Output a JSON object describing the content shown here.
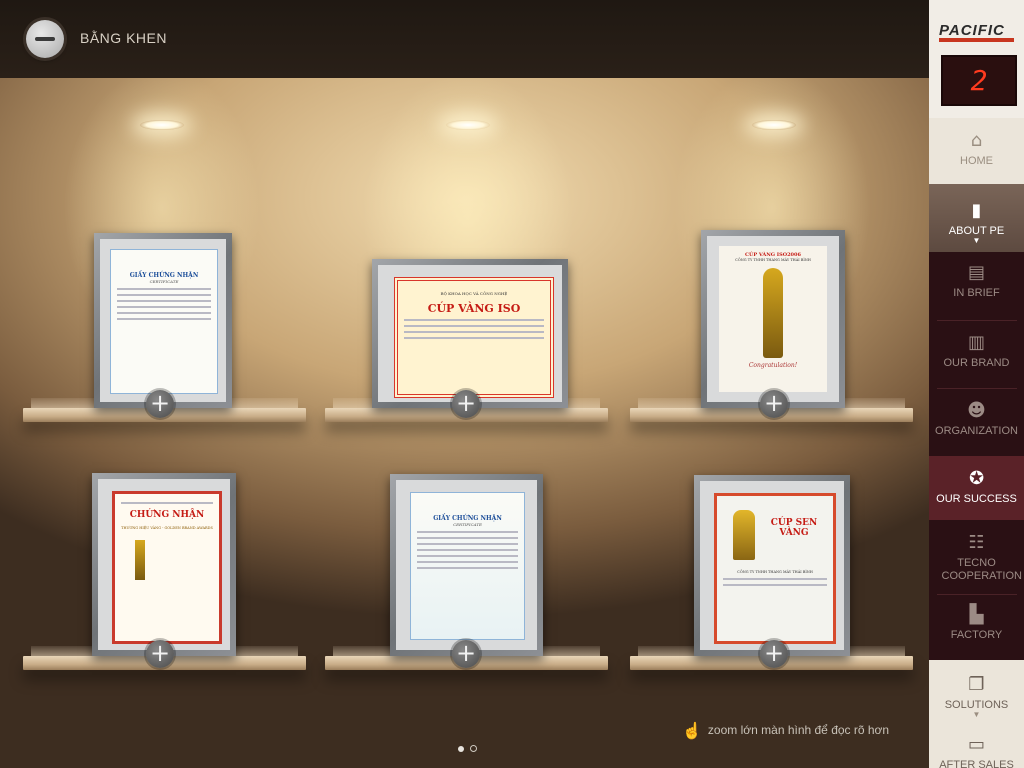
{
  "header": {
    "title": "BẰNG KHEN"
  },
  "brand": {
    "logo_text": "PACIFIC",
    "floor_indicator": "2"
  },
  "nav": {
    "home": "HOME",
    "about": "ABOUT PE",
    "in_brief": "IN BRIEF",
    "our_brand": "OUR BRAND",
    "organization": "ORGANIZATION",
    "our_success": "OUR SUCCESS",
    "tecno": "TECNO COOPERATION",
    "factory": "FACTORY",
    "solutions": "SOLUTIONS",
    "after_sales": "AFTER SALES"
  },
  "certificates": [
    {
      "title": "GIẤY CHỨNG NHẬN",
      "subtitle": "CERTIFICATE"
    },
    {
      "title": "CÚP VÀNG ISO",
      "subtitle": "BỘ KHOA HỌC VÀ CÔNG NGHỆ"
    },
    {
      "title": "CÚP VÀNG ISO2006",
      "subtitle": "CÔNG TY TNHH THANG MÁY THÁI BÌNH",
      "footer": "Congratulation!"
    },
    {
      "title": "CHỨNG NHẬN",
      "subtitle": "THƯƠNG HIỆU VÀNG - GOLDEN BRAND AWARDS"
    },
    {
      "title": "GIẤY CHỨNG NHẬN",
      "subtitle": "CERTIFICATE"
    },
    {
      "title": "CÚP SEN VÀNG",
      "subtitle": "CÔNG TY TNHH THANG MÁY THÁI BÌNH"
    }
  ],
  "zoom_button": "+",
  "hint_text": "zoom lớn màn hình để đọc rõ hơn",
  "colors": {
    "sidebar": "#2a1014",
    "active_nav": "#5a2228",
    "accent": "#c8361f"
  }
}
